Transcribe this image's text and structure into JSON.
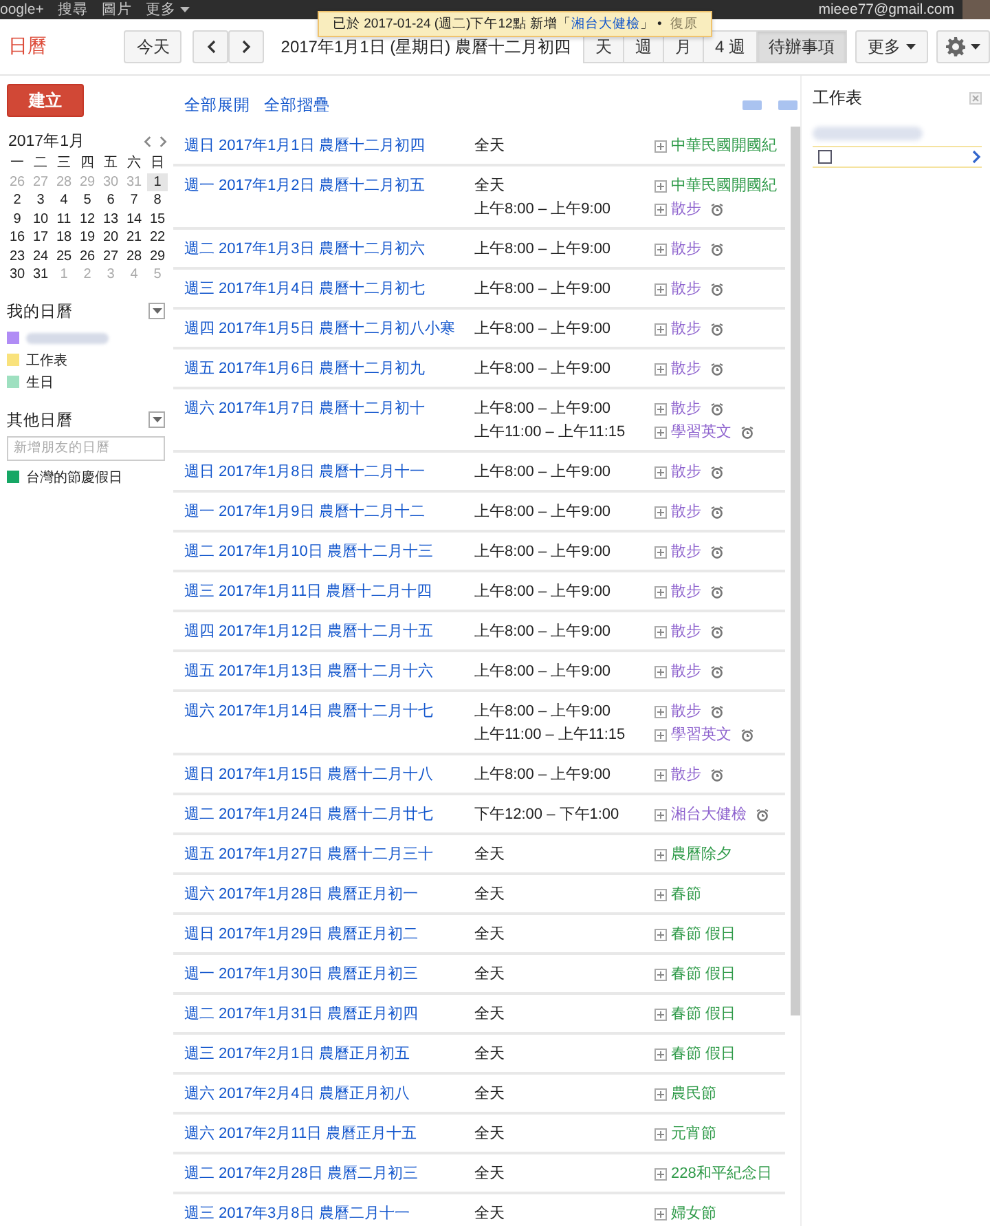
{
  "top_bar": {
    "links": [
      "oogle+",
      "搜尋",
      "圖片",
      "更多"
    ],
    "email": "mieee77@gmail.com"
  },
  "notice": {
    "message": "已於 2017-01-24 (週二)下午12點 新增「",
    "link": "湘台大健檢",
    "message_end": "」 •",
    "undo": "復原"
  },
  "header": {
    "app_title": "日曆",
    "today": "今天",
    "date_title": "2017年1月1日 (星期日) 農曆十二月初四",
    "views": [
      {
        "label": "天",
        "selected": false
      },
      {
        "label": "週",
        "selected": false
      },
      {
        "label": "月",
        "selected": false
      },
      {
        "label": "4 週",
        "selected": false
      },
      {
        "label": "待辦事項",
        "selected": true
      }
    ],
    "more": "更多"
  },
  "sidebar": {
    "create": "建立",
    "mini_calendar": {
      "title": "2017年1月",
      "weekdays": [
        "一",
        "二",
        "三",
        "四",
        "五",
        "六",
        "日"
      ],
      "days": [
        {
          "day": "26",
          "dimmed": true,
          "selected": false
        },
        {
          "day": "27",
          "dimmed": true,
          "selected": false
        },
        {
          "day": "28",
          "dimmed": true,
          "selected": false
        },
        {
          "day": "29",
          "dimmed": true,
          "selected": false
        },
        {
          "day": "30",
          "dimmed": true,
          "selected": false
        },
        {
          "day": "31",
          "dimmed": true,
          "selected": false
        },
        {
          "day": "1",
          "dimmed": false,
          "selected": true
        },
        {
          "day": "2",
          "dimmed": false,
          "selected": false
        },
        {
          "day": "3",
          "dimmed": false,
          "selected": false
        },
        {
          "day": "4",
          "dimmed": false,
          "selected": false
        },
        {
          "day": "5",
          "dimmed": false,
          "selected": false
        },
        {
          "day": "6",
          "dimmed": false,
          "selected": false
        },
        {
          "day": "7",
          "dimmed": false,
          "selected": false
        },
        {
          "day": "8",
          "dimmed": false,
          "selected": false
        },
        {
          "day": "9",
          "dimmed": false,
          "selected": false
        },
        {
          "day": "10",
          "dimmed": false,
          "selected": false
        },
        {
          "day": "11",
          "dimmed": false,
          "selected": false
        },
        {
          "day": "12",
          "dimmed": false,
          "selected": false
        },
        {
          "day": "13",
          "dimmed": false,
          "selected": false
        },
        {
          "day": "14",
          "dimmed": false,
          "selected": false
        },
        {
          "day": "15",
          "dimmed": false,
          "selected": false
        },
        {
          "day": "16",
          "dimmed": false,
          "selected": false
        },
        {
          "day": "17",
          "dimmed": false,
          "selected": false
        },
        {
          "day": "18",
          "dimmed": false,
          "selected": false
        },
        {
          "day": "19",
          "dimmed": false,
          "selected": false
        },
        {
          "day": "20",
          "dimmed": false,
          "selected": false
        },
        {
          "day": "21",
          "dimmed": false,
          "selected": false
        },
        {
          "day": "22",
          "dimmed": false,
          "selected": false
        },
        {
          "day": "23",
          "dimmed": false,
          "selected": false
        },
        {
          "day": "24",
          "dimmed": false,
          "selected": false
        },
        {
          "day": "25",
          "dimmed": false,
          "selected": false
        },
        {
          "day": "26",
          "dimmed": false,
          "selected": false
        },
        {
          "day": "27",
          "dimmed": false,
          "selected": false
        },
        {
          "day": "28",
          "dimmed": false,
          "selected": false
        },
        {
          "day": "29",
          "dimmed": false,
          "selected": false
        },
        {
          "day": "30",
          "dimmed": false,
          "selected": false
        },
        {
          "day": "31",
          "dimmed": false,
          "selected": false
        },
        {
          "day": "1",
          "dimmed": true,
          "selected": false
        },
        {
          "day": "2",
          "dimmed": true,
          "selected": false
        },
        {
          "day": "3",
          "dimmed": true,
          "selected": false
        },
        {
          "day": "4",
          "dimmed": true,
          "selected": false
        },
        {
          "day": "5",
          "dimmed": true,
          "selected": false
        }
      ]
    },
    "my_calendars": {
      "title": "我的日曆",
      "items": [
        {
          "color": "#b08cf5"
        },
        {
          "label": "工作表",
          "color": "#f9e27c"
        },
        {
          "label": "生日",
          "color": "#9ee0c0"
        }
      ]
    },
    "other_calendars": {
      "title": "其他日曆",
      "placeholder": "新增朋友的日曆",
      "items": [
        {
          "label": "台灣的節慶假日",
          "color": "#16a765"
        }
      ]
    }
  },
  "agenda": {
    "expand_all": "全部展開",
    "collapse_all": "全部摺疊",
    "days": [
      {
        "date": "週日 2017年1月1日 農曆十二月初四",
        "events": [
          {
            "time": "全天",
            "title": "中華民國開國紀",
            "color": "#2e9a48",
            "alarm": false
          }
        ]
      },
      {
        "date": "週一 2017年1月2日 農曆十二月初五",
        "events": [
          {
            "time": "全天",
            "title": "中華民國開國紀",
            "color": "#2e9a48",
            "alarm": false
          },
          {
            "time": "上午8:00 – 上午9:00",
            "title": "散步",
            "color": "#8e63ce",
            "alarm": true
          }
        ]
      },
      {
        "date": "週二 2017年1月3日 農曆十二月初六",
        "events": [
          {
            "time": "上午8:00 – 上午9:00",
            "title": "散步",
            "color": "#8e63ce",
            "alarm": true
          }
        ]
      },
      {
        "date": "週三 2017年1月4日 農曆十二月初七",
        "events": [
          {
            "time": "上午8:00 – 上午9:00",
            "title": "散步",
            "color": "#8e63ce",
            "alarm": true
          }
        ]
      },
      {
        "date": "週四 2017年1月5日 農曆十二月初八小寒",
        "events": [
          {
            "time": "上午8:00 – 上午9:00",
            "title": "散步",
            "color": "#8e63ce",
            "alarm": true
          }
        ]
      },
      {
        "date": "週五 2017年1月6日 農曆十二月初九",
        "events": [
          {
            "time": "上午8:00 – 上午9:00",
            "title": "散步",
            "color": "#8e63ce",
            "alarm": true
          }
        ]
      },
      {
        "date": "週六 2017年1月7日 農曆十二月初十",
        "events": [
          {
            "time": "上午8:00 – 上午9:00",
            "title": "散步",
            "color": "#8e63ce",
            "alarm": true
          },
          {
            "time": "上午11:00 – 上午11:15",
            "title": "學習英文",
            "color": "#8e63ce",
            "alarm": true
          }
        ]
      },
      {
        "date": "週日 2017年1月8日 農曆十二月十一",
        "events": [
          {
            "time": "上午8:00 – 上午9:00",
            "title": "散步",
            "color": "#8e63ce",
            "alarm": true
          }
        ]
      },
      {
        "date": "週一 2017年1月9日 農曆十二月十二",
        "events": [
          {
            "time": "上午8:00 – 上午9:00",
            "title": "散步",
            "color": "#8e63ce",
            "alarm": true
          }
        ]
      },
      {
        "date": "週二 2017年1月10日 農曆十二月十三",
        "events": [
          {
            "time": "上午8:00 – 上午9:00",
            "title": "散步",
            "color": "#8e63ce",
            "alarm": true
          }
        ]
      },
      {
        "date": "週三 2017年1月11日 農曆十二月十四",
        "events": [
          {
            "time": "上午8:00 – 上午9:00",
            "title": "散步",
            "color": "#8e63ce",
            "alarm": true
          }
        ]
      },
      {
        "date": "週四 2017年1月12日 農曆十二月十五",
        "events": [
          {
            "time": "上午8:00 – 上午9:00",
            "title": "散步",
            "color": "#8e63ce",
            "alarm": true
          }
        ]
      },
      {
        "date": "週五 2017年1月13日 農曆十二月十六",
        "events": [
          {
            "time": "上午8:00 – 上午9:00",
            "title": "散步",
            "color": "#8e63ce",
            "alarm": true
          }
        ]
      },
      {
        "date": "週六 2017年1月14日 農曆十二月十七",
        "events": [
          {
            "time": "上午8:00 – 上午9:00",
            "title": "散步",
            "color": "#8e63ce",
            "alarm": true
          },
          {
            "time": "上午11:00 – 上午11:15",
            "title": "學習英文",
            "color": "#8e63ce",
            "alarm": true
          }
        ]
      },
      {
        "date": "週日 2017年1月15日 農曆十二月十八",
        "events": [
          {
            "time": "上午8:00 – 上午9:00",
            "title": "散步",
            "color": "#8e63ce",
            "alarm": true
          }
        ]
      },
      {
        "date": "週二 2017年1月24日 農曆十二月廿七",
        "events": [
          {
            "time": "下午12:00 – 下午1:00",
            "title": "湘台大健檢",
            "color": "#8e63ce",
            "alarm": true
          }
        ]
      },
      {
        "date": "週五 2017年1月27日 農曆十二月三十",
        "events": [
          {
            "time": "全天",
            "title": "農曆除夕",
            "color": "#2e9a48",
            "alarm": false
          }
        ]
      },
      {
        "date": "週六 2017年1月28日 農曆正月初一",
        "events": [
          {
            "time": "全天",
            "title": "春節",
            "color": "#2e9a48",
            "alarm": false
          }
        ]
      },
      {
        "date": "週日 2017年1月29日 農曆正月初二",
        "events": [
          {
            "time": "全天",
            "title": "春節 假日",
            "color": "#2e9a48",
            "alarm": false
          }
        ]
      },
      {
        "date": "週一 2017年1月30日 農曆正月初三",
        "events": [
          {
            "time": "全天",
            "title": "春節 假日",
            "color": "#2e9a48",
            "alarm": false
          }
        ]
      },
      {
        "date": "週二 2017年1月31日 農曆正月初四",
        "events": [
          {
            "time": "全天",
            "title": "春節 假日",
            "color": "#2e9a48",
            "alarm": false
          }
        ]
      },
      {
        "date": "週三 2017年2月1日 農曆正月初五",
        "events": [
          {
            "time": "全天",
            "title": "春節 假日",
            "color": "#2e9a48",
            "alarm": false
          }
        ]
      },
      {
        "date": "週六 2017年2月4日 農曆正月初八",
        "events": [
          {
            "time": "全天",
            "title": "農民節",
            "color": "#2e9a48",
            "alarm": false
          }
        ]
      },
      {
        "date": "週六 2017年2月11日 農曆正月十五",
        "events": [
          {
            "time": "全天",
            "title": "元宵節",
            "color": "#2e9a48",
            "alarm": false
          }
        ]
      },
      {
        "date": "週二 2017年2月28日 農曆二月初三",
        "events": [
          {
            "time": "全天",
            "title": "228和平紀念日",
            "color": "#2e9a48",
            "alarm": false
          }
        ]
      },
      {
        "date": "週三 2017年3月8日 農曆二月十一",
        "events": [
          {
            "time": "全天",
            "title": "婦女節",
            "color": "#2e9a48",
            "alarm": false
          }
        ]
      }
    ]
  },
  "tasks": {
    "title": "工作表",
    "items": [
      {
        "checked": false
      }
    ]
  }
}
